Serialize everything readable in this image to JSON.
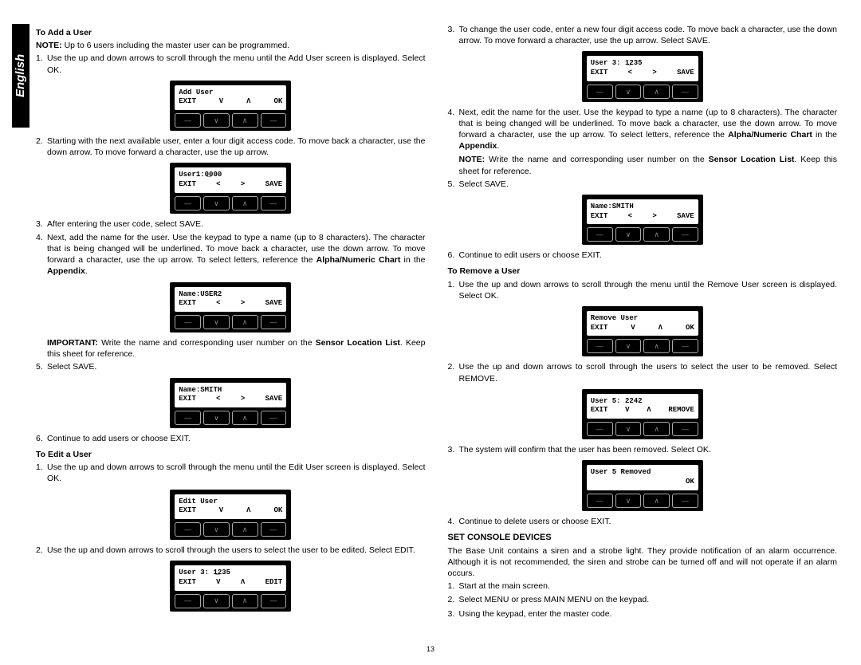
{
  "langTab": "English",
  "pageNumber": "13",
  "left": {
    "addUser": {
      "heading": "To Add a User",
      "noteLabel": "NOTE:",
      "note": "Up to 6 users including the master user can be programmed.",
      "li1": "Use the up and down arrows to scroll through the menu until the Add User screen is displayed. Select OK.",
      "dev1": {
        "line1": "Add User",
        "b1": "EXIT",
        "b2": "V",
        "b3": "Λ",
        "b4": "OK"
      },
      "li2": "Starting with the next available user, enter a four digit access code. To move back a character, use the down arrow. To move forward a character, use the up arrow.",
      "dev2": {
        "line1": "User1:0̲000",
        "b1": "EXIT",
        "b2": "<",
        "b3": ">",
        "b4": "SAVE"
      },
      "li3": "After entering the user code, select SAVE.",
      "li4a": "Next, add the name for the user. Use the keypad to type a name (up to 8 characters). The character that is being changed will be underlined. To move back a character, use the down arrow. To move forward a character, use the up arrow. To select letters, reference the ",
      "li4bold": "Alpha/Numeric Chart",
      "li4mid": " in the ",
      "li4bold2": "Appendix",
      "li4end": ".",
      "dev3": {
        "line1": "Name:USER2",
        "b1": "EXIT",
        "b2": "<",
        "b3": ">",
        "b4": "SAVE"
      },
      "impLabel": "IMPORTANT:",
      "impA": " Write the name and corresponding user number on the ",
      "impBold": "Sensor Location List",
      "impB": ". Keep this sheet for reference.",
      "li5": "Select SAVE.",
      "dev4": {
        "line1": "Name:SMITH",
        "b1": "EXIT",
        "b2": "<",
        "b3": ">",
        "b4": "SAVE"
      },
      "li6": "Continue to add users or choose EXIT."
    },
    "editUser": {
      "heading": "To Edit a User",
      "li1": "Use the up and down arrows to scroll through the menu until the Edit User screen is displayed. Select OK.",
      "dev1": {
        "line1": "Edit User",
        "b1": "EXIT",
        "b2": "V",
        "b3": "Λ",
        "b4": "OK"
      },
      "li2": "Use the up and down arrows to scroll through the users to select the user to be edited. Select EDIT.",
      "dev2": {
        "line1": "User 3: 1̲235",
        "b1": "EXIT",
        "b2": "V",
        "b3": "Λ",
        "b4": "EDIT"
      }
    }
  },
  "right": {
    "li3": "To change the user code, enter a new four digit access code. To move back a character, use the down arrow. To move forward a character, use the up arrow. Select SAVE.",
    "dev3": {
      "line1": "User 3: 1̲235",
      "b1": "EXIT",
      "b2": "<",
      "b3": ">",
      "b4": "SAVE"
    },
    "li4a": "Next, edit the name for the user. Use the keypad to type a name (up to 8 characters). The character that is being changed will be underlined. To move back a character, use the down arrow. To move forward a character, use the up arrow. To select letters, reference the ",
    "li4bold": "Alpha/Numeric Chart",
    "li4mid": " in the ",
    "li4bold2": "Appendix",
    "li4end": ".",
    "noteLabel": "NOTE:",
    "noteA": " Write the name and corresponding user number on the ",
    "noteBold": "Sensor Location List",
    "noteB": ". Keep this sheet for reference.",
    "li5": "Select SAVE.",
    "dev4": {
      "line1": "Name:SMITH",
      "b1": "EXIT",
      "b2": "<",
      "b3": ">",
      "b4": "SAVE"
    },
    "li6": "Continue to edit users or choose EXIT.",
    "removeUser": {
      "heading": "To Remove a User",
      "li1": "Use the up and down arrows to scroll through the menu until the Remove User screen is displayed. Select OK.",
      "dev1": {
        "line1": "Remove User",
        "b1": "EXIT",
        "b2": "V",
        "b3": "Λ",
        "b4": "OK"
      },
      "li2": "Use the up and down arrows to scroll through the users to select the user to be removed. Select REMOVE.",
      "dev2": {
        "line1": "User 5: 2242",
        "b1": "EXIT",
        "b2": "V",
        "b3": "Λ",
        "b4": "REMOVE"
      },
      "li3": "The system will confirm that the user has been removed. Select OK.",
      "dev3": {
        "line1": "User 5 Removed",
        "b4": "OK"
      },
      "li4": "Continue to delete users or choose EXIT."
    },
    "console": {
      "heading": "SET CONSOLE DEVICES",
      "p": "The Base Unit contains a siren and a strobe light. They provide notification of an alarm occurrence. Although it is not recommended, the siren and strobe can be turned off and will not operate if an alarm occurs.",
      "li1": "Start at the main screen.",
      "li2": "Select MENU or press MAIN MENU on the keypad.",
      "li3": "Using the keypad, enter the master code."
    }
  }
}
